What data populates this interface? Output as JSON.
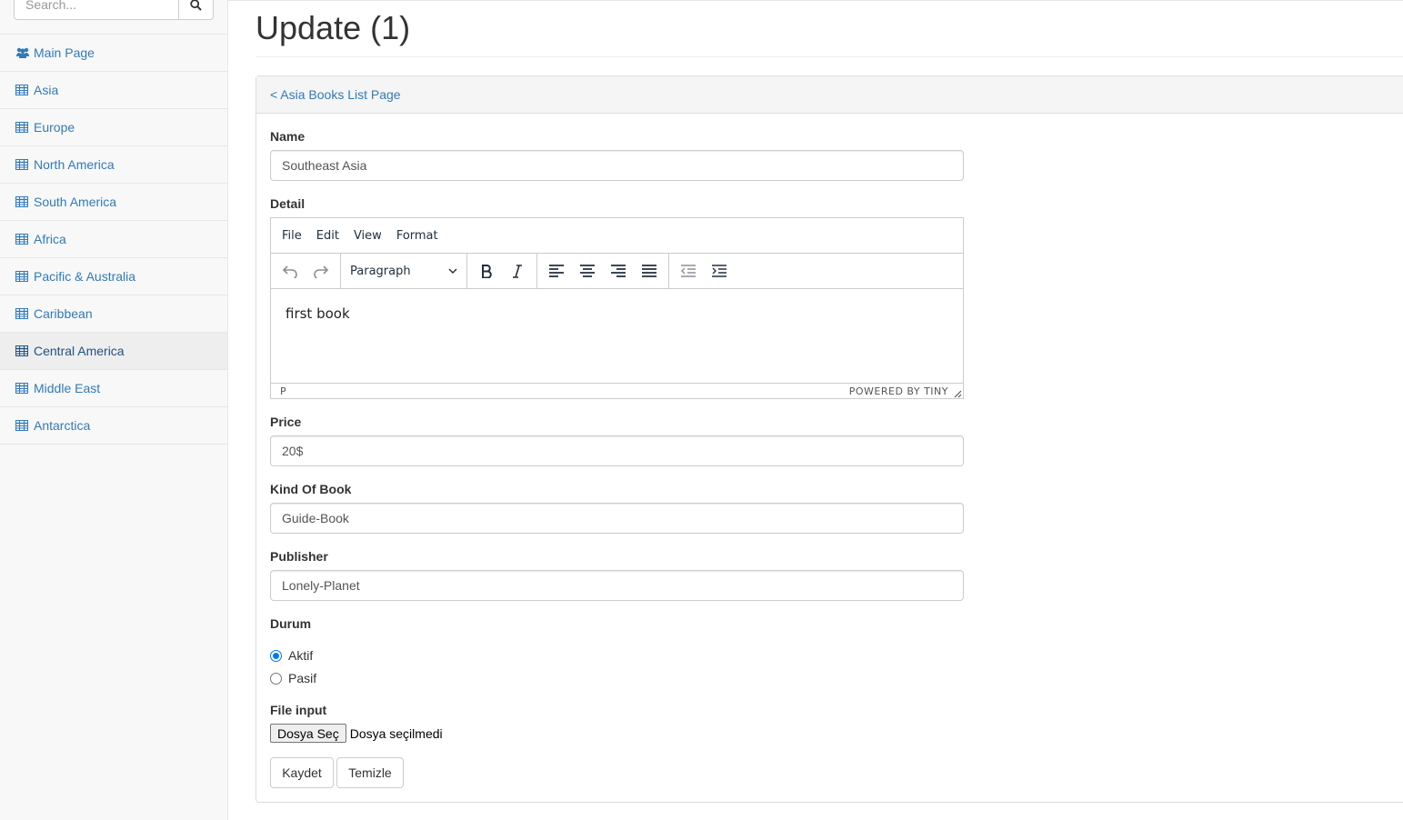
{
  "sidebar": {
    "search_placeholder": "Search...",
    "items": [
      {
        "label": "Main Page",
        "icon": "users-icon"
      },
      {
        "label": "Asia",
        "icon": "table-icon"
      },
      {
        "label": "Europe",
        "icon": "table-icon"
      },
      {
        "label": "North America",
        "icon": "table-icon"
      },
      {
        "label": "South America",
        "icon": "table-icon"
      },
      {
        "label": "Africa",
        "icon": "table-icon"
      },
      {
        "label": "Pacific & Australia",
        "icon": "table-icon"
      },
      {
        "label": "Caribbean",
        "icon": "table-icon"
      },
      {
        "label": "Central America",
        "icon": "table-icon",
        "active": true
      },
      {
        "label": "Middle East",
        "icon": "table-icon"
      },
      {
        "label": "Antarctica",
        "icon": "table-icon"
      }
    ]
  },
  "page": {
    "title": "Update (1)",
    "back_link": "< Asia Books List Page"
  },
  "form": {
    "name_label": "Name",
    "name_value": "Southeast Asia",
    "detail_label": "Detail",
    "editor": {
      "menu": [
        "File",
        "Edit",
        "View",
        "Format"
      ],
      "format_select": "Paragraph",
      "content": "first book",
      "status_path": "P",
      "branding": "POWERED BY TINY"
    },
    "price_label": "Price",
    "price_value": "20$",
    "kind_label": "Kind Of Book",
    "kind_value": "Guide-Book",
    "publisher_label": "Publisher",
    "publisher_value": "Lonely-Planet",
    "durum_label": "Durum",
    "durum_options": [
      {
        "label": "Aktif",
        "checked": true
      },
      {
        "label": "Pasif",
        "checked": false
      }
    ],
    "file_label": "File input",
    "file_button": "Dosya Seç",
    "file_status": "Dosya seçilmedi",
    "save_button": "Kaydet",
    "clear_button": "Temizle"
  },
  "colors": {
    "link": "#337ab7",
    "radio_accent": "#0075ff"
  }
}
